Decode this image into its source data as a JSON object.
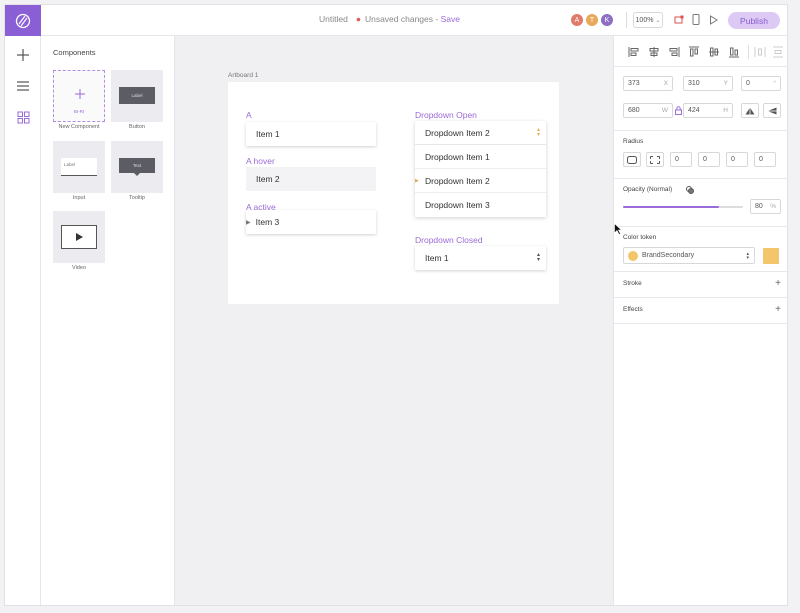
{
  "colors": {
    "accent": "#9b6bd8",
    "logo_bg": "#8a5fd6",
    "publish_bg": "#dcc9f4",
    "token_swatch": "#f4c66b",
    "avatar_a": "#e07b6a",
    "avatar_t": "#e8a95a",
    "avatar_k": "#8f6fc4"
  },
  "topbar": {
    "doc_title": "Untitled",
    "unsaved": "Unsaved changes",
    "separator": " - ",
    "save_label": "Save",
    "avatars": [
      "A",
      "T",
      "K"
    ],
    "zoom": "100%",
    "publish_label": "Publish"
  },
  "rail": {
    "icons": [
      "plus-icon",
      "menu-icon",
      "grid-icon"
    ]
  },
  "components": {
    "title": "Components",
    "tiles": [
      {
        "label": "New Component",
        "mini": "BI-RI"
      },
      {
        "label": "Button",
        "mini": "Label"
      },
      {
        "label": "Input",
        "mini": "Label"
      },
      {
        "label": "Tooltip",
        "mini": "Text"
      },
      {
        "label": "Video",
        "mini": ""
      }
    ]
  },
  "artboard": {
    "label": "Artboard 1",
    "a_label": "A",
    "a_item": "Item 1",
    "a_hover_label": "A hover",
    "a_hover_item": "Item 2",
    "a_active_label": "A active",
    "a_active_item": "Item 3",
    "dropdown_open_label": "Dropdown Open",
    "dropdown_open_selected": "Dropdown Item 2",
    "dropdown_open_items": [
      "Dropdown Item 1",
      "Dropdown Item 2",
      "Dropdown Item 3"
    ],
    "dropdown_closed_label": "Dropdown Closed",
    "dropdown_closed_value": "Item 1"
  },
  "props": {
    "x": "373",
    "x_unit": "X",
    "y": "310",
    "y_unit": "Y",
    "rotation": "0",
    "rotation_unit": "°",
    "w": "680",
    "w_unit": "W",
    "h": "424",
    "h_unit": "H",
    "radius_title": "Radius",
    "radius_values": [
      "0",
      "0",
      "0",
      "0"
    ],
    "opacity_title": "Opacity (Normal)",
    "opacity_value": "80",
    "opacity_unit": "%",
    "opacity_fraction": 0.8,
    "color_token_title": "Color token",
    "color_token_value": "BrandSecondary",
    "stroke_title": "Stroke",
    "effects_title": "Effects"
  }
}
